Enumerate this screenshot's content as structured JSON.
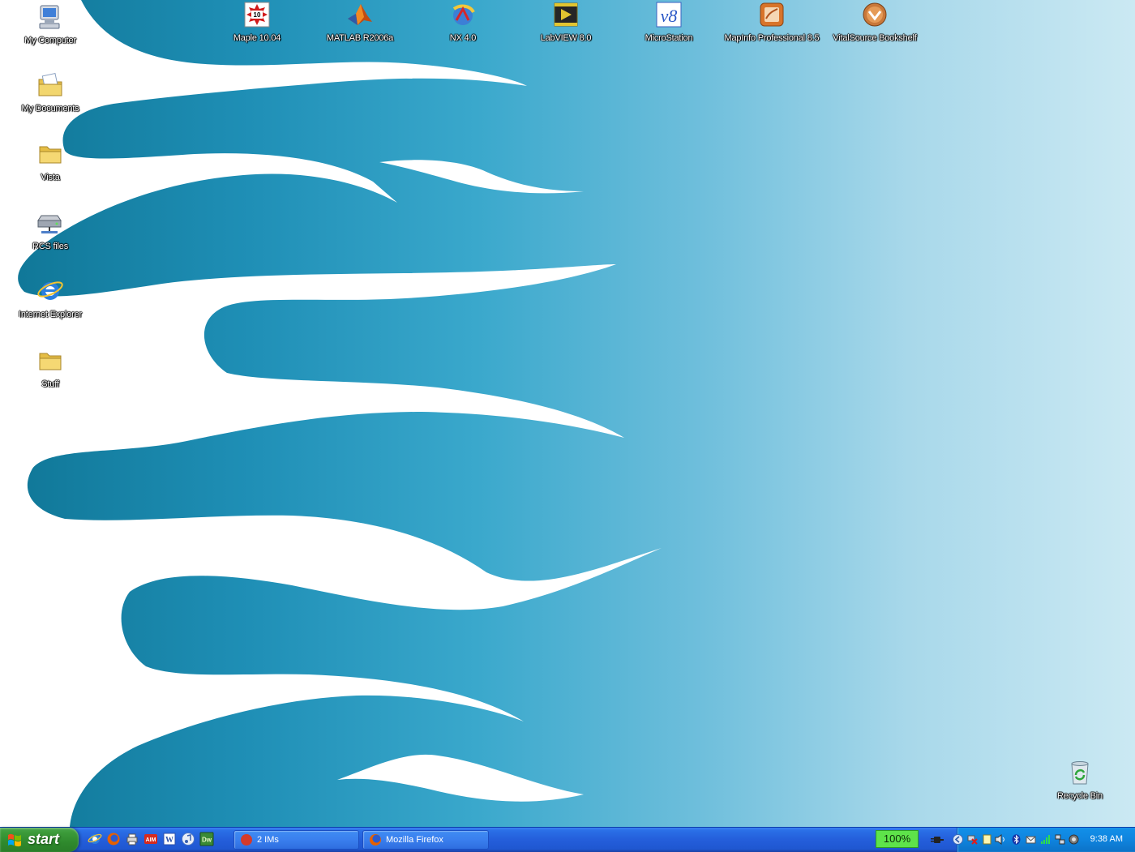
{
  "desktop": {
    "left_icons": [
      {
        "label": "My Computer",
        "icon": "my-computer-icon"
      },
      {
        "label": "My Documents",
        "icon": "my-documents-icon"
      },
      {
        "label": "Vista",
        "icon": "folder-icon"
      },
      {
        "label": "RCS files",
        "icon": "network-drive-icon"
      },
      {
        "label": "Internet Explorer",
        "icon": "internet-explorer-icon"
      },
      {
        "label": "Stuff",
        "icon": "folder-icon"
      }
    ],
    "top_icons": [
      {
        "label": "Maple 10.04",
        "icon": "maple-icon"
      },
      {
        "label": "MATLAB R2006a",
        "icon": "matlab-icon"
      },
      {
        "label": "NX 4.0",
        "icon": "nx-icon"
      },
      {
        "label": "LabVIEW 8.0",
        "icon": "labview-icon"
      },
      {
        "label": "MicroStation",
        "icon": "microstation-icon"
      },
      {
        "label": "MapInfo Professional 8.5",
        "icon": "mapinfo-icon"
      },
      {
        "label": "VitalSource Bookshelf",
        "icon": "vitalsource-icon"
      }
    ],
    "recycle_bin": {
      "label": "Recycle Bin",
      "icon": "recycle-bin-icon"
    },
    "colors": {
      "wallpaper_dark": "#127a9b",
      "wallpaper_mid": "#2ea3c8",
      "wallpaper_light": "#c7e7f2"
    }
  },
  "taskbar": {
    "start_label": "start",
    "quick_launch": [
      "internet-explorer-icon",
      "firefox-icon",
      "printer-icon",
      "aim-icon",
      "word-icon",
      "itunes-icon",
      "dreamweaver-icon"
    ],
    "tasks": [
      {
        "label": "2 IMs",
        "icon": "im-icon"
      },
      {
        "label": "Mozilla Firefox",
        "icon": "firefox-icon"
      }
    ],
    "zoom": "100%",
    "tray_icons": [
      "power-icon",
      "back-icon",
      "network-error-icon",
      "notepad-icon",
      "speaker-icon",
      "bluetooth-icon",
      "mail-icon",
      "signal-icon",
      "network-icon",
      "shield-icon"
    ],
    "clock": "9:38 AM"
  }
}
